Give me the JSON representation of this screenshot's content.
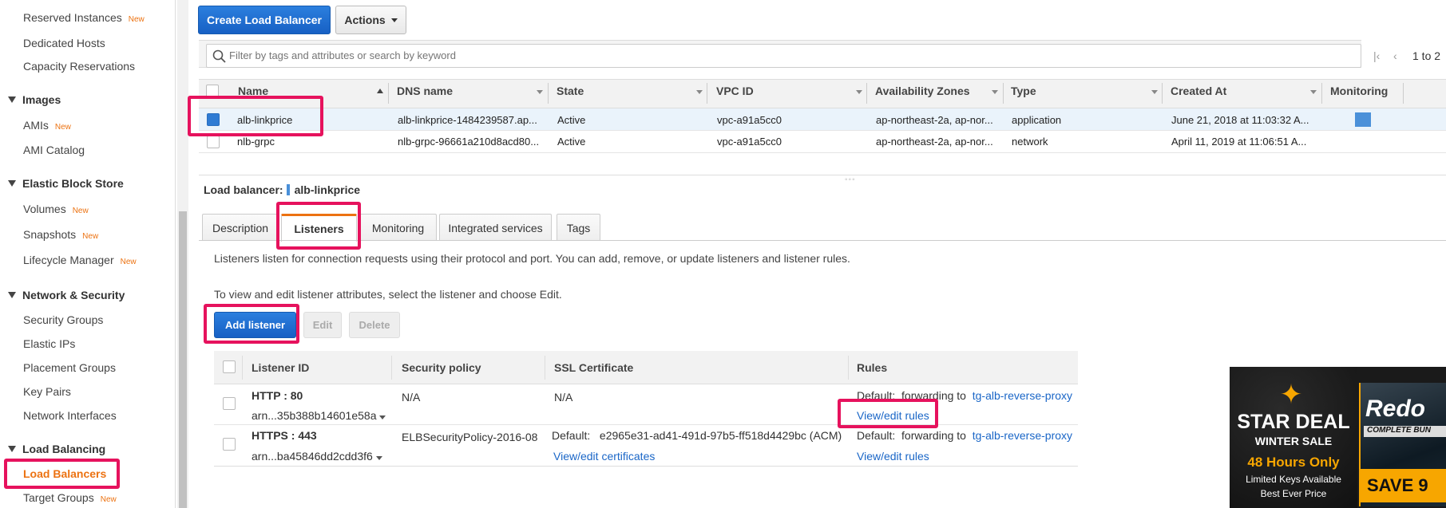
{
  "sidebar": {
    "items": [
      {
        "label": "Reserved Instances",
        "badge": "New"
      },
      {
        "label": "Dedicated Hosts",
        "badge": ""
      },
      {
        "label": "Capacity Reservations",
        "badge": ""
      }
    ],
    "groups": [
      {
        "label": "Images",
        "items": [
          {
            "label": "AMIs",
            "badge": "New"
          },
          {
            "label": "AMI Catalog",
            "badge": ""
          }
        ]
      },
      {
        "label": "Elastic Block Store",
        "items": [
          {
            "label": "Volumes",
            "badge": "New"
          },
          {
            "label": "Snapshots",
            "badge": "New"
          },
          {
            "label": "Lifecycle Manager",
            "badge": "New"
          }
        ]
      },
      {
        "label": "Network & Security",
        "items": [
          {
            "label": "Security Groups",
            "badge": ""
          },
          {
            "label": "Elastic IPs",
            "badge": ""
          },
          {
            "label": "Placement Groups",
            "badge": ""
          },
          {
            "label": "Key Pairs",
            "badge": ""
          },
          {
            "label": "Network Interfaces",
            "badge": ""
          }
        ]
      },
      {
        "label": "Load Balancing",
        "items": [
          {
            "label": "Load Balancers",
            "badge": ""
          },
          {
            "label": "Target Groups",
            "badge": "New"
          }
        ]
      }
    ]
  },
  "toolbar": {
    "create_label": "Create Load Balancer",
    "actions_label": "Actions"
  },
  "search": {
    "placeholder": "Filter by tags and attributes or search by keyword"
  },
  "pager": {
    "text": "1 to 2"
  },
  "table": {
    "columns": [
      "Name",
      "DNS name",
      "State",
      "VPC ID",
      "Availability Zones",
      "Type",
      "Created At",
      "Monitoring"
    ],
    "rows": [
      {
        "name": "alb-linkprice",
        "dns": "alb-linkprice-1484239587.ap...",
        "state": "Active",
        "vpc": "vpc-a91a5cc0",
        "az": "ap-northeast-2a, ap-nor...",
        "type": "application",
        "created": "June 21, 2018 at 11:03:32 A...",
        "selected": true
      },
      {
        "name": "nlb-grpc",
        "dns": "nlb-grpc-96661a210d8acd80...",
        "state": "Active",
        "vpc": "vpc-a91a5cc0",
        "az": "ap-northeast-2a, ap-nor...",
        "type": "network",
        "created": "April 11, 2019 at 11:06:51 A...",
        "selected": false
      }
    ]
  },
  "detail": {
    "label": "Load balancer:",
    "lb_name": "alb-linkprice",
    "tabs": [
      "Description",
      "Listeners",
      "Monitoring",
      "Integrated services",
      "Tags"
    ],
    "active_tab": "Listeners",
    "intro": "Listeners listen for connection requests using their protocol and port. You can add, remove, or update listeners and listener rules.",
    "hint": "To view and edit listener attributes, select the listener and choose Edit.",
    "buttons": {
      "add": "Add listener",
      "edit": "Edit",
      "delete": "Delete"
    }
  },
  "listeners": {
    "columns": [
      "Listener ID",
      "Security policy",
      "SSL Certificate",
      "Rules"
    ],
    "rows": [
      {
        "id": "HTTP : 80",
        "arn": "arn...35b388b14601e58a",
        "policy": "N/A",
        "cert": "N/A",
        "cert_link": "",
        "rule_default": "Default:",
        "rule_forward": "forwarding to",
        "rule_target": "tg-alb-reverse-proxy",
        "rule_link": "View/edit rules"
      },
      {
        "id": "HTTPS : 443",
        "arn": "arn...ba45846dd2cdd3f6",
        "policy": "ELBSecurityPolicy-2016-08",
        "cert": "Default:   e2965e31-ad41-491d-97b5-ff518d4429bc (ACM)",
        "cert_link": "View/edit certificates",
        "rule_default": "Default:",
        "rule_forward": "forwarding to",
        "rule_target": "tg-alb-reverse-proxy",
        "rule_link": "View/edit rules"
      }
    ]
  },
  "ad": {
    "line1": "STAR DEAL",
    "line2": "WINTER SALE",
    "line3": "48 Hours Only",
    "line4": "Limited Keys Available",
    "line5": "Best Ever Price",
    "game_title": "Redo",
    "game_sub": "COMPLETE BUN",
    "save": "SAVE 9"
  },
  "colors": {
    "highlight": "#e6125d",
    "accent": "#ec7211",
    "primary": "#1d6fd0",
    "link": "#1a66c7"
  }
}
